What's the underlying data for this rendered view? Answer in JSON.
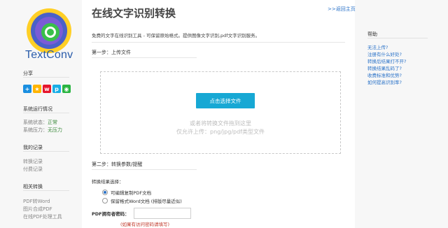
{
  "brand": {
    "logo_text": "TextConv"
  },
  "sidebar": {
    "share_title": "分享",
    "share_buttons": [
      "plus-icon",
      "star-icon",
      "weibo-icon",
      "qzone-icon",
      "wechat-icon"
    ],
    "status_title": "系统运行情况",
    "status_label": "系统状态：",
    "status_value": "正常",
    "pressure_label": "系统压力：",
    "pressure_value": "无压力",
    "records_title": "我的记录",
    "records": [
      "转换记录",
      "付费记录"
    ],
    "related_title": "相关转换",
    "related": [
      "PDF转Word",
      "图片合成PDF",
      "在线PDF处理工具"
    ]
  },
  "header": {
    "title": "在线文字识别转换",
    "back_link": ">>返回主页"
  },
  "main": {
    "intro": "免费的文字在线识别工具 - 可保留原始格式。提供图像文字识别,pdf文字识别服务。",
    "step1_title": "第一步：上传文件",
    "upload_button": "点击选择文件",
    "drop_hint": "或者将转换文件拖到这里",
    "type_hint": "仅允许上传：png/jpg/pdf类型文件",
    "step2_title": "第二步：转换参数/提醒",
    "result_label": "转换结果选择：",
    "options": [
      {
        "label": "可编辑复制PDF文档",
        "selected": true
      },
      {
        "label": "保留格式Word文档 (排版尽量近似)",
        "selected": false
      }
    ],
    "password_label": "PDF拥有者密码：",
    "password_value": "",
    "password_note": "(如果有访问密码请填写)"
  },
  "help": {
    "title": "帮助",
    "items": [
      "无法上传?",
      "注册有什么好处?",
      "转换后结果打不开?",
      "转换结果乱码了?",
      "收费标准和优势?",
      "如何提高识别率?"
    ]
  },
  "colors": {
    "accent": "#17a8d4",
    "link": "#2a72c8",
    "warning": "#c0392b",
    "ok": "#3a8a3a"
  }
}
